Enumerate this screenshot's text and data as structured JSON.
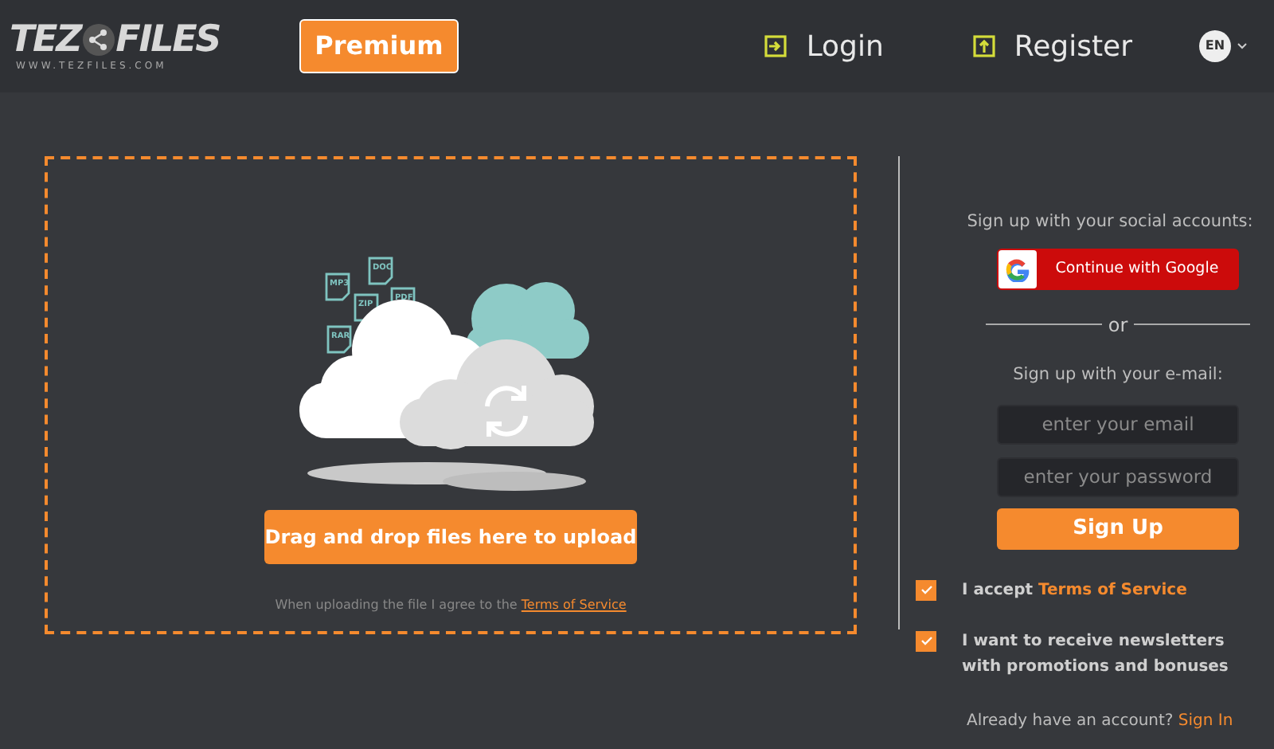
{
  "header": {
    "logo": {
      "left": "TEZ",
      "right": "FILES",
      "domain": "WWW.TEZFILES.COM"
    },
    "premium": "Premium",
    "nav": [
      {
        "label": "Login",
        "kind": "login"
      },
      {
        "label": "Register",
        "kind": "register"
      }
    ],
    "language": "EN"
  },
  "upload": {
    "file_types": [
      "MP3",
      "DOC",
      "ZIP",
      "PDF",
      "RAR"
    ],
    "button": "Drag and drop files here to upload",
    "note": "When uploading the file I agree to the ",
    "note_link": "Terms of Service"
  },
  "signup": {
    "social_heading": "Sign up with your social accounts:",
    "google": "Continue with Google",
    "or": "or",
    "email_heading": "Sign up with your e-mail:",
    "email": {
      "placeholder": "enter your email"
    },
    "password": {
      "placeholder": "enter your password"
    },
    "submit": "Sign Up",
    "checks": [
      {
        "text": "I accept ",
        "link": "Terms of Service",
        "checked": true
      },
      {
        "text": "I want to receive newsletters with promotions and bonuses",
        "checked": true
      }
    ],
    "footer": "Already have an account? ",
    "footer_link": "Sign In"
  }
}
